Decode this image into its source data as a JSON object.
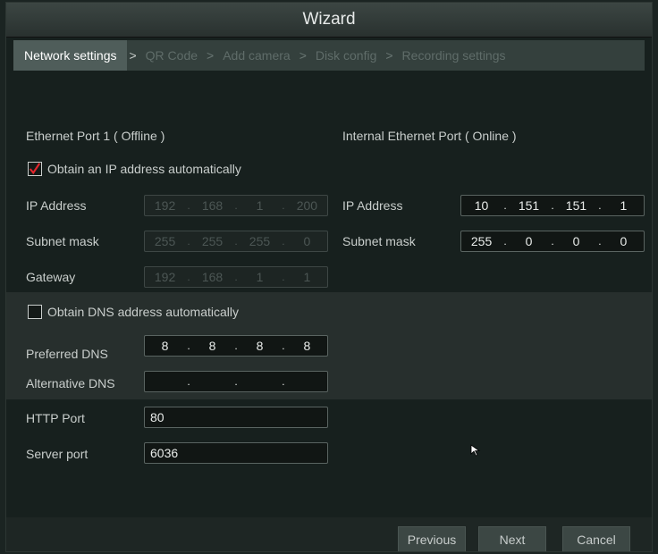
{
  "window": {
    "title": "Wizard"
  },
  "steps": [
    {
      "label": "Network settings"
    },
    {
      "label": "QR Code"
    },
    {
      "label": "Add camera"
    },
    {
      "label": "Disk config"
    },
    {
      "label": "Recording settings"
    }
  ],
  "arrow_glyph": ">",
  "ethernet1": {
    "title": "Ethernet Port 1 ( Offline )",
    "auto_ip_label": "Obtain an IP address automatically",
    "auto_ip_checked": true,
    "ip_label": "IP Address",
    "ip": [
      "192",
      "168",
      "1",
      "200"
    ],
    "subnet_label": "Subnet mask",
    "subnet": [
      "255",
      "255",
      "255",
      "0"
    ],
    "gateway_label": "Gateway",
    "gateway": [
      "192",
      "168",
      "1",
      "1"
    ]
  },
  "internal": {
    "title": "Internal Ethernet Port ( Online )",
    "ip_label": "IP Address",
    "ip": [
      "10",
      "151",
      "151",
      "1"
    ],
    "subnet_label": "Subnet mask",
    "subnet": [
      "255",
      "0",
      "0",
      "0"
    ]
  },
  "dns": {
    "auto_label": "Obtain DNS address automatically",
    "auto_checked": false,
    "preferred_label": "Preferred DNS",
    "preferred": [
      "8",
      "8",
      "8",
      "8"
    ],
    "alternative_label": "Alternative DNS",
    "alternative": [
      "",
      "",
      "",
      ""
    ]
  },
  "ports": {
    "http_label": "HTTP Port",
    "http_value": "80",
    "server_label": "Server port",
    "server_value": "6036"
  },
  "buttons": {
    "previous": "Previous",
    "next": "Next",
    "cancel": "Cancel"
  },
  "ip_separator": "."
}
